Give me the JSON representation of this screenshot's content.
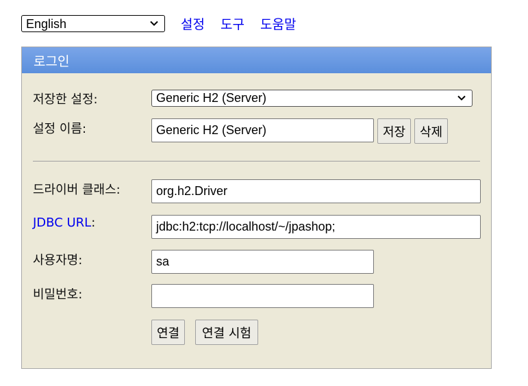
{
  "top": {
    "language": "English",
    "links": [
      "설정",
      "도구",
      "도움말"
    ]
  },
  "panel": {
    "title": "로그인",
    "saved_settings_label": "저장한 설정:",
    "saved_settings_value": "Generic H2 (Server)",
    "setting_name_label": "설정 이름:",
    "setting_name_value": "Generic H2 (Server)",
    "save_button": "저장",
    "delete_button": "삭제",
    "driver_class_label": "드라이버 클래스:",
    "driver_class_value": "org.h2.Driver",
    "jdbc_url_label": "JDBC URL",
    "colon": ":",
    "jdbc_url_value": "jdbc:h2:tcp://localhost/~/jpashop;",
    "username_label": "사용자명:",
    "username_value": "sa",
    "password_label": "비밀번호:",
    "password_value": "",
    "connect_button": "연결",
    "test_connection_button": "연결 시험"
  }
}
